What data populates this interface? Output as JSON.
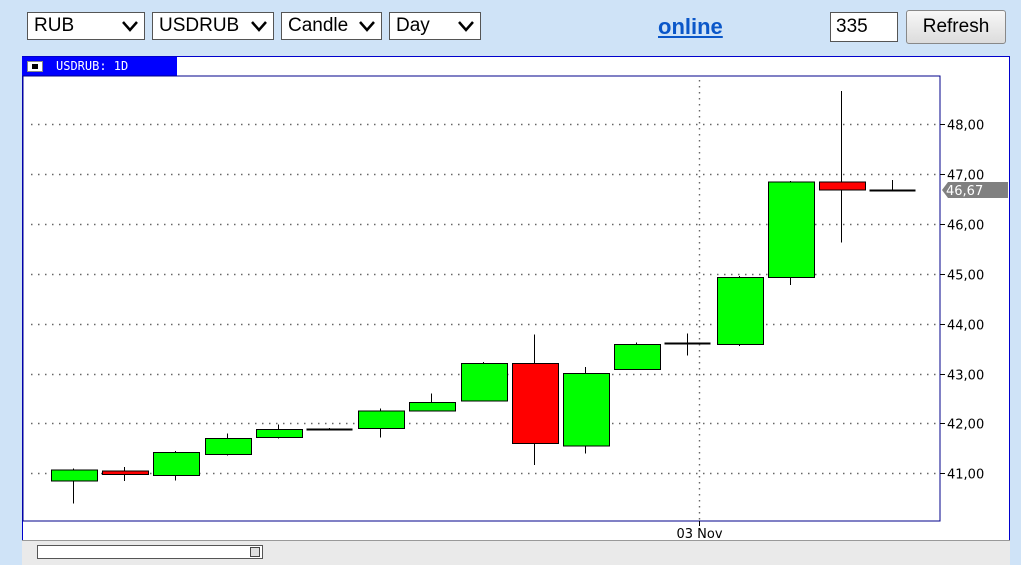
{
  "toolbar": {
    "currency": "RUB",
    "symbol": "USDRUB",
    "chart_type": "Candle",
    "period": "Day",
    "online_link": "online",
    "bars_count": "335",
    "refresh_label": "Refresh"
  },
  "chart_tab_label": "USDRUB: 1D",
  "colors": {
    "up": "#00ff00",
    "down": "#ff0000",
    "frame": "#0000cc",
    "tab": "#0000ff"
  },
  "chart_data": {
    "type": "candlestick",
    "title": "USDRUB: 1D",
    "y_ticks": [
      "41,00",
      "42,00",
      "43,00",
      "44,00",
      "45,00",
      "46,00",
      "47,00",
      "48,00"
    ],
    "y_tick_values": [
      41,
      42,
      43,
      44,
      45,
      46,
      47,
      48
    ],
    "ylim": [
      40.05,
      48.95
    ],
    "x_tick_label": "03 Nov",
    "x_tick_index": 12,
    "last_price": 46.67,
    "last_price_label": "46,67",
    "grid": true,
    "candles": [
      {
        "open": 40.85,
        "close": 41.07,
        "high": 41.1,
        "low": 40.4
      },
      {
        "open": 41.05,
        "close": 40.98,
        "high": 41.13,
        "low": 40.85
      },
      {
        "open": 40.96,
        "close": 41.42,
        "high": 41.45,
        "low": 40.86
      },
      {
        "open": 41.38,
        "close": 41.7,
        "high": 41.8,
        "low": 41.36
      },
      {
        "open": 41.72,
        "close": 41.88,
        "high": 41.98,
        "low": 41.7
      },
      {
        "open": 41.88,
        "close": 41.9,
        "high": 41.91,
        "low": 41.87
      },
      {
        "open": 41.9,
        "close": 42.25,
        "high": 42.3,
        "low": 41.72
      },
      {
        "open": 42.25,
        "close": 42.42,
        "high": 42.6,
        "low": 42.24
      },
      {
        "open": 42.45,
        "close": 43.2,
        "high": 43.23,
        "low": 42.44
      },
      {
        "open": 43.2,
        "close": 41.6,
        "high": 43.78,
        "low": 41.17
      },
      {
        "open": 41.55,
        "close": 43.0,
        "high": 43.13,
        "low": 41.4
      },
      {
        "open": 43.08,
        "close": 43.58,
        "high": 43.62,
        "low": 43.07
      },
      {
        "open": 43.58,
        "close": 43.6,
        "high": 43.8,
        "low": 43.36
      },
      {
        "open": 43.58,
        "close": 44.92,
        "high": 44.95,
        "low": 43.55
      },
      {
        "open": 44.92,
        "close": 46.83,
        "high": 46.85,
        "low": 44.77
      },
      {
        "open": 46.83,
        "close": 46.67,
        "high": 48.65,
        "low": 45.62
      },
      {
        "open": 46.67,
        "close": 46.67,
        "high": 46.87,
        "low": 46.65
      }
    ]
  }
}
